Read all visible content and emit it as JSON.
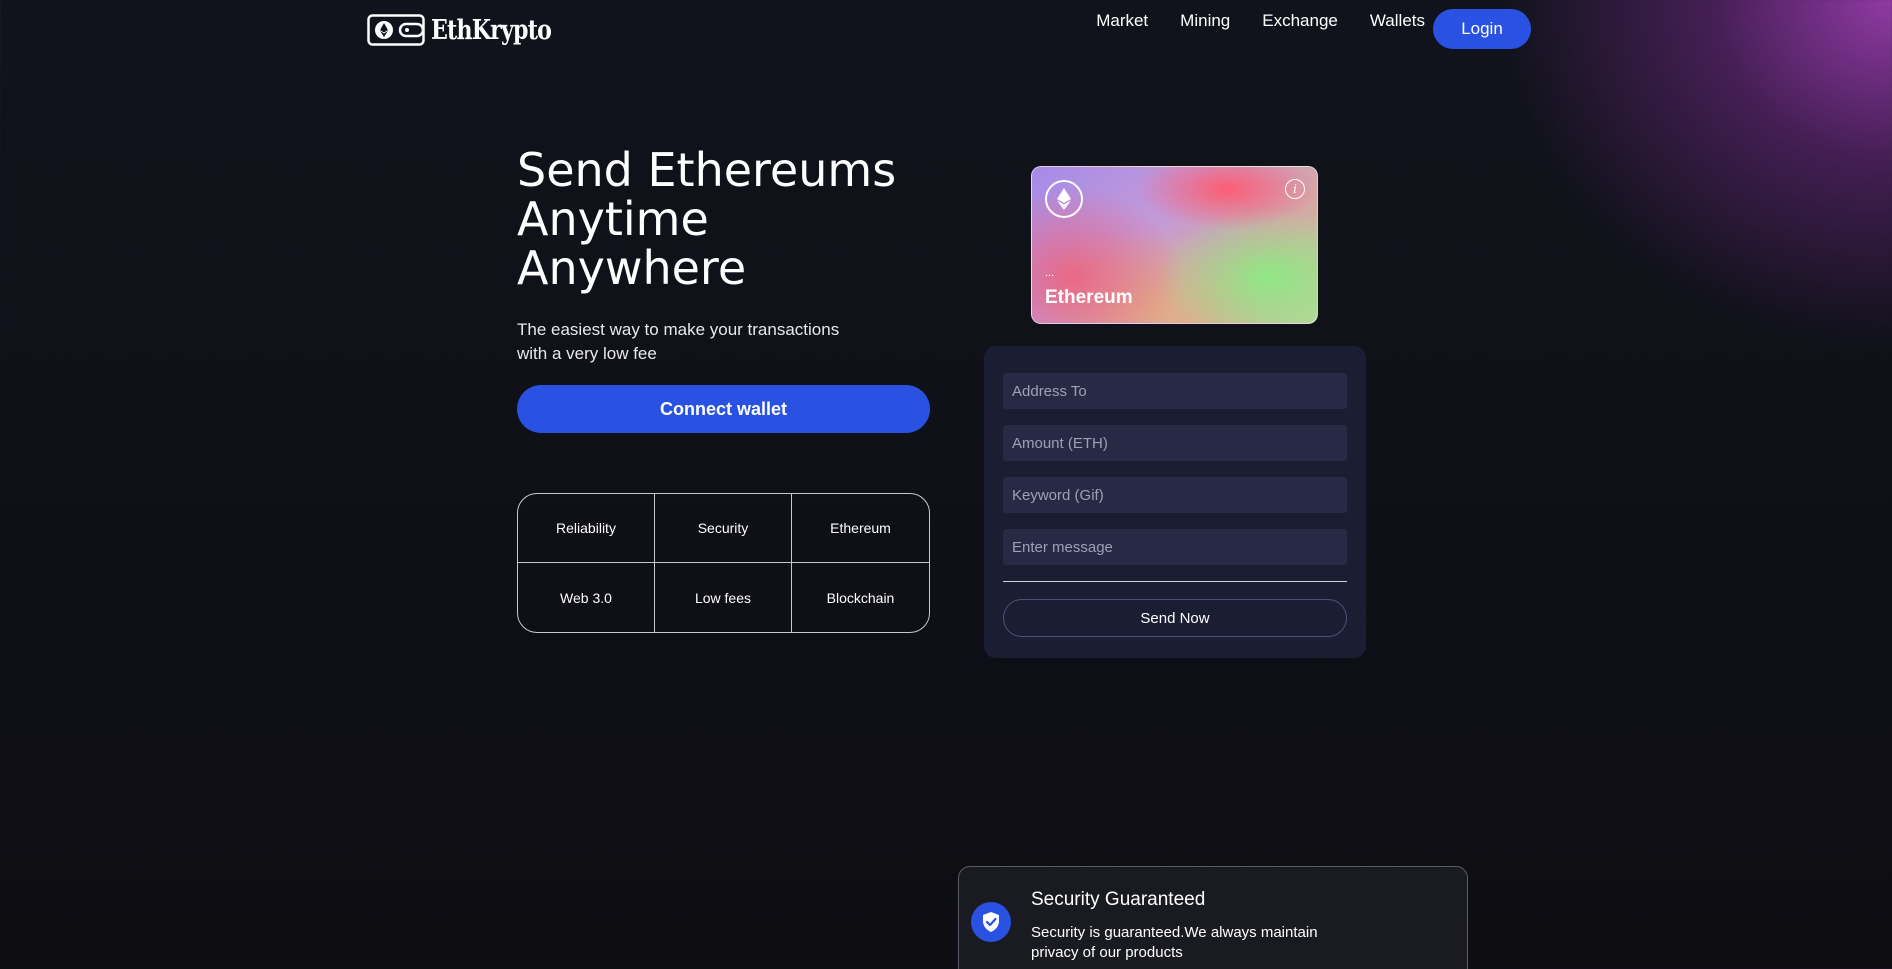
{
  "brand": {
    "name": "EthKrypto",
    "logo_icon": "wallet-icon"
  },
  "nav": {
    "items": [
      {
        "label": "Market"
      },
      {
        "label": "Mining"
      },
      {
        "label": "Exchange"
      },
      {
        "label": "Wallets"
      }
    ],
    "login_label": "Login"
  },
  "hero": {
    "title_lines": [
      "Send Ethereums",
      "Anytime",
      "Anywhere"
    ],
    "subtitle_lines": [
      "The easiest way to make your transactions",
      "with a very low fee"
    ],
    "connect_label": "Connect wallet"
  },
  "features": [
    {
      "label": "Reliability"
    },
    {
      "label": "Security"
    },
    {
      "label": "Ethereum"
    },
    {
      "label": "Web 3.0"
    },
    {
      "label": "Low fees"
    },
    {
      "label": "Blockchain"
    }
  ],
  "eth_card": {
    "address": "...",
    "name": "Ethereum",
    "icon": "ethereum-icon",
    "info_icon": "info-icon"
  },
  "form": {
    "address_placeholder": "Address To",
    "amount_placeholder": "Amount (ETH)",
    "keyword_placeholder": "Keyword (Gif)",
    "message_placeholder": "Enter message",
    "send_label": "Send Now"
  },
  "security_card": {
    "title": "Security Guaranteed",
    "text": "Security is guaranteed.We always maintain privacy of our products",
    "icon": "shield-check-icon"
  },
  "colors": {
    "accent": "#2952e3",
    "form_bg": "#1b1e33",
    "input_bg": "#272a44",
    "page_bg": "#0f1017"
  }
}
